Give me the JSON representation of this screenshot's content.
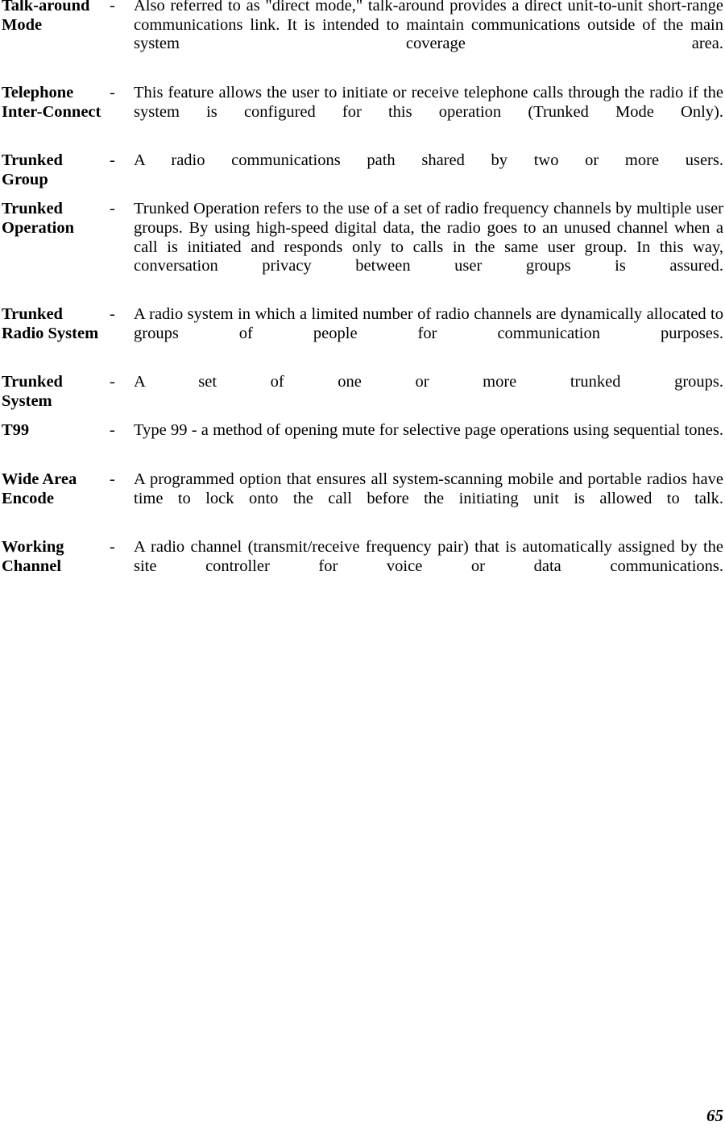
{
  "document": {
    "type": "glossary-page",
    "page_number": "65",
    "separator": "-"
  },
  "entries": [
    {
      "term": "Talk-around Mode",
      "dash": "-",
      "description": "Also referred to as \"direct mode,\" talk-around provides a direct unit-to-unit short-range communications link. It is intended to maintain communications outside of the main system coverage area."
    },
    {
      "term": "Telephone Inter-Connect",
      "dash": "-",
      "description": "This feature allows the user to initiate or receive telephone calls through the radio if the system is configured for this operation (Trunked Mode Only)."
    },
    {
      "term": "Trunked Group",
      "dash": "-",
      "description": "A radio communications path shared by two or more users."
    },
    {
      "term": "Trunked Operation",
      "dash": "-",
      "description": "Trunked Operation refers to the use of a set of radio frequency channels by multiple user groups. By using high-speed digital data, the radio goes to an unused channel when a call is initiated and responds only to calls in the same user group. In this way, conversation privacy between user groups is assured."
    },
    {
      "term": "Trunked Radio System",
      "dash": "-",
      "description": "A radio system in which a limited number of radio channels are dynamically allocated to groups of people for communication purposes."
    },
    {
      "term": "Trunked System",
      "dash": "-",
      "description": "A set of one or more trunked groups."
    },
    {
      "term": "T99",
      "dash": "-",
      "description": "Type 99 - a method of opening mute for selective page operations using sequential tones."
    },
    {
      "term": "Wide Area Encode",
      "dash": "-",
      "description": "A programmed option that ensures all system-scanning mobile and portable radios have time to lock onto the call before the initiating unit is allowed to talk."
    },
    {
      "term": "Working Channel",
      "dash": "-",
      "description": "A radio channel (transmit/receive frequency pair) that is automatically assigned by the site controller for voice or data communications."
    }
  ]
}
